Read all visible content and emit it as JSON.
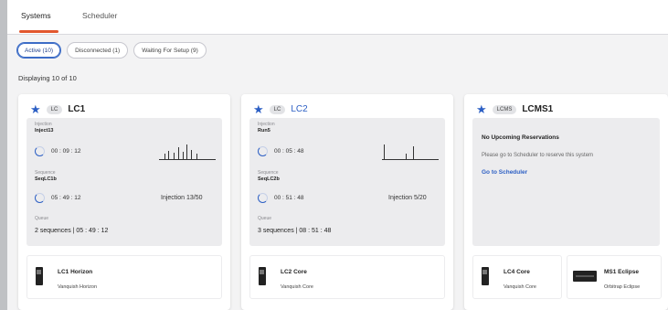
{
  "tabs": [
    {
      "label": "Systems",
      "active": true
    },
    {
      "label": "Scheduler",
      "active": false
    }
  ],
  "filters": [
    {
      "label": "Active (10)",
      "active": true
    },
    {
      "label": "Disconnected (1)",
      "active": false
    },
    {
      "label": "Waiting For Setup (9)",
      "active": false
    }
  ],
  "displaying": "Displaying 10 of 10",
  "accent_color": "#2c5fc4",
  "cards": [
    {
      "badge": "LC",
      "name": "LC1",
      "injection_label": "Injection",
      "injection_name": "Inject13",
      "injection_time": "00 : 09 : 12",
      "sequence_label": "Sequence",
      "sequence_name": "SeqLC1b",
      "sequence_time": "05 : 49 : 12",
      "injection_count": "Injection 13/50",
      "queue_label": "Queue",
      "queue_text": "2 sequences | 05 : 49 : 12",
      "module_name": "LC1 Horizon",
      "module_model": "Vanquish Horizon"
    },
    {
      "badge": "LC",
      "name": "LC2",
      "injection_label": "Injection",
      "injection_name": "Run5",
      "injection_time": "00 : 05 : 48",
      "sequence_label": "Sequence",
      "sequence_name": "SeqLC2b",
      "sequence_time": "00 : 51 : 48",
      "injection_count": "Injection 5/20",
      "queue_label": "Queue",
      "queue_text": "3 sequences | 08 : 51 : 48",
      "module_name": "LC2 Core",
      "module_model": "Vanquish Core"
    },
    {
      "badge": "LCMS",
      "name": "LCMS1",
      "no_reservations": "No Upcoming Reservations",
      "please_text": "Please go to Scheduler to reserve this system",
      "goto_link": "Go to Scheduler",
      "modules": [
        {
          "name": "LC4 Core",
          "model": "Vanquish Core"
        },
        {
          "name": "MS1 Eclipse",
          "model": "Orbitrap Eclipse"
        }
      ]
    }
  ]
}
